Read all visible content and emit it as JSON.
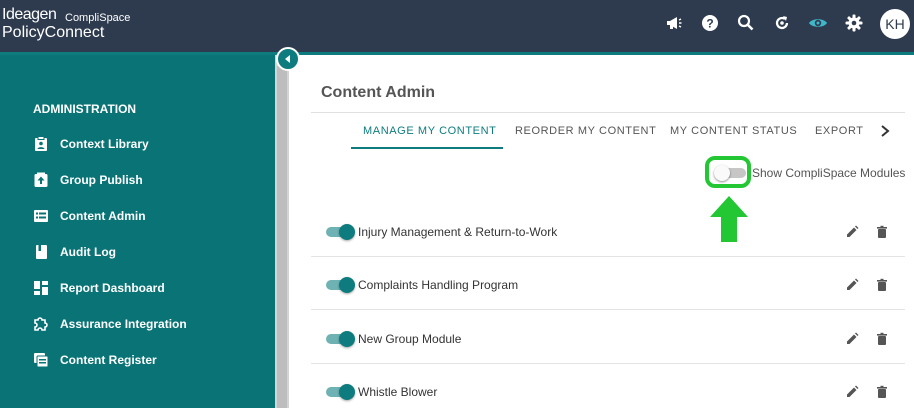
{
  "header": {
    "brand": "Ideagen",
    "sub_brand": "CompliSpace",
    "product": "PolicyConnect",
    "icons": [
      "megaphone-icon",
      "help-icon",
      "search-icon",
      "refresh-icon",
      "eye-icon",
      "gear-icon"
    ],
    "avatar_initials": "KH",
    "colors": {
      "bar": "#2e3b4e",
      "accent": "#0e7c7f",
      "active_icon": "#3fb7c8"
    }
  },
  "sidebar": {
    "heading": "ADMINISTRATION",
    "items": [
      {
        "label": "Context Library",
        "icon": "clipboard-icon"
      },
      {
        "label": "Group Publish",
        "icon": "publish-icon"
      },
      {
        "label": "Content Admin",
        "icon": "list-icon"
      },
      {
        "label": "Audit Log",
        "icon": "book-icon"
      },
      {
        "label": "Report Dashboard",
        "icon": "dashboard-icon"
      },
      {
        "label": "Assurance Integration",
        "icon": "puzzle-icon"
      },
      {
        "label": "Content Register",
        "icon": "register-icon"
      }
    ],
    "colors": {
      "background": "#0a7376"
    }
  },
  "main": {
    "title": "Content Admin",
    "tabs": [
      {
        "label": "MANAGE MY CONTENT",
        "active": true
      },
      {
        "label": "REORDER MY CONTENT",
        "active": false
      },
      {
        "label": "MY CONTENT STATUS",
        "active": false
      },
      {
        "label": "EXPORT MY CONTENT",
        "active": false
      }
    ],
    "show_modules": {
      "label": "Show CompliSpace Modules",
      "checked": false
    },
    "highlight_color": "#22c733",
    "rows": [
      {
        "name": "Injury Management & Return-to-Work",
        "enabled": true
      },
      {
        "name": "Complaints Handling Program",
        "enabled": true
      },
      {
        "name": "New Group Module",
        "enabled": true
      },
      {
        "name": "Whistle Blower",
        "enabled": true
      }
    ]
  }
}
